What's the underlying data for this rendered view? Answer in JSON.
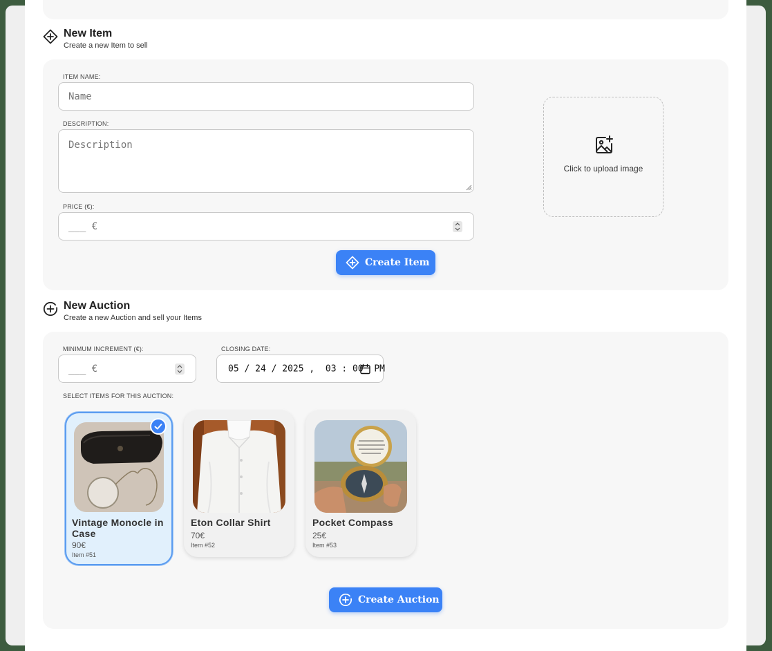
{
  "new_item": {
    "title": "New Item",
    "subtitle": "Create a new Item to sell",
    "name_label": "ITEM NAME:",
    "name_placeholder": "Name",
    "description_label": "DESCRIPTION:",
    "description_placeholder": "Description",
    "price_label": "PRICE (€):",
    "price_placeholder": "___ €",
    "upload_text": "Click to upload image",
    "create_button": "Create Item"
  },
  "new_auction": {
    "title": "New Auction",
    "subtitle": "Create a new Auction and sell your Items",
    "min_increment_label": "MINIMUM INCREMENT (€):",
    "min_increment_placeholder": "___ €",
    "closing_date_label": "CLOSING DATE:",
    "closing_date_value": "05 / 24 / 2025 ,  03 : 00  PM",
    "select_items_label": "SELECT ITEMS FOR THIS AUCTION:",
    "items": [
      {
        "name": "Vintage Monocle in Case",
        "price": "90€",
        "number": "Item #51",
        "selected": true,
        "image": "monocle-photo"
      },
      {
        "name": "Eton Collar Shirt",
        "price": "70€",
        "number": "Item #52",
        "selected": false,
        "image": "white-shirt-photo"
      },
      {
        "name": "Pocket Compass",
        "price": "25€",
        "number": "Item #53",
        "selected": false,
        "image": "compass-photo"
      }
    ],
    "create_button": "Create Auction"
  },
  "colors": {
    "accent": "#3b82f6",
    "selected_card_bg": "#e1f0fc",
    "panel_bg": "#f7f7f7"
  }
}
